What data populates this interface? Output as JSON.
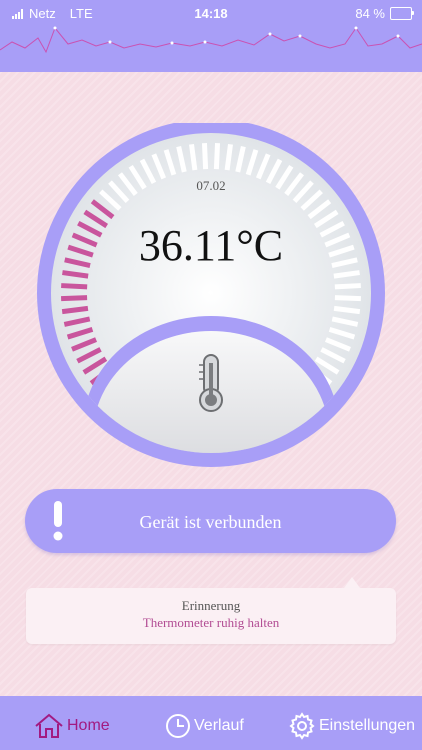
{
  "status_bar": {
    "carrier": "Netz",
    "network": "LTE",
    "time": "14:18",
    "battery": "84 %",
    "battery_level": 0.84
  },
  "reading": {
    "date": "07.02",
    "temperature": "36.11°C",
    "level": 0.3
  },
  "device_status": {
    "text": "Gerät ist verbunden",
    "icon": "exclamation-icon"
  },
  "reminder": {
    "title": "Erinnerung",
    "message": "Thermometer ruhig halten"
  },
  "tabs": [
    {
      "label": "Home",
      "icon": "home-icon",
      "active": true
    },
    {
      "label": "Verlauf",
      "icon": "clock-icon",
      "active": false
    },
    {
      "label": "Einstellungen",
      "icon": "gear-icon",
      "active": false
    }
  ],
  "colors": {
    "accent": "#a89ef7",
    "gauge_active": "#c9559d",
    "gauge_inactive": "#ffffff",
    "active_tab": "#a21a82",
    "background": "#f6dde5"
  }
}
